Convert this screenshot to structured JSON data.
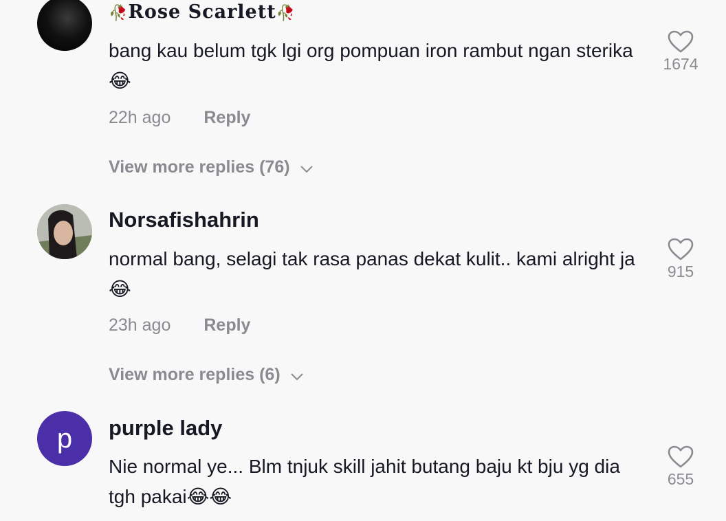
{
  "comments": [
    {
      "username": "Rose Scarlett",
      "username_decoration": "🥀",
      "text": "bang kau belum tgk lgi org pompuan iron rambut ngan sterika😂",
      "time": "22h ago",
      "reply_label": "Reply",
      "likes": "1674",
      "more_replies": "View more replies (76)"
    },
    {
      "username": "Norsafishahrin",
      "text": "normal bang, selagi tak rasa panas dekat kulit.. kami alright ja😂",
      "time": "23h ago",
      "reply_label": "Reply",
      "likes": "915",
      "more_replies": "View more replies (6)"
    },
    {
      "username": "purple lady",
      "avatar_letter": "p",
      "avatar_color": "#4b2fa8",
      "text": "Nie normal ye... Blm tnjuk skill jahit butang baju kt bju yg dia tgh pakai😂😂",
      "likes": "655"
    }
  ],
  "icons": {
    "like": "heart-outline-icon",
    "expand": "chevron-down-icon"
  }
}
